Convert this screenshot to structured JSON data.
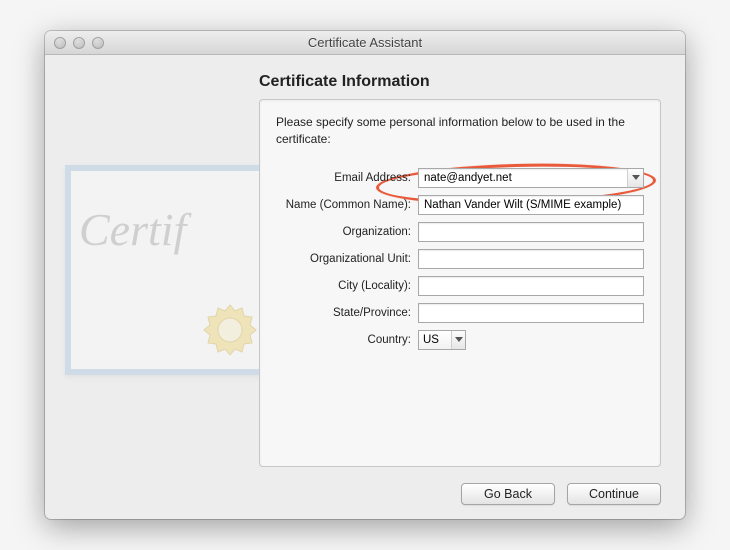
{
  "window": {
    "title": "Certificate Assistant"
  },
  "heading": "Certificate Information",
  "instruction": "Please specify some personal information below to be used in the certificate:",
  "cert_bg_text": "Certif",
  "form": {
    "email_label": "Email Address:",
    "email_value": "nate@andyet.net",
    "name_label": "Name (Common Name):",
    "name_value": "Nathan Vander Wilt (S/MIME example)",
    "org_label": "Organization:",
    "org_value": "",
    "ou_label": "Organizational Unit:",
    "ou_value": "",
    "city_label": "City (Locality):",
    "city_value": "",
    "state_label": "State/Province:",
    "state_value": "",
    "country_label": "Country:",
    "country_value": "US"
  },
  "buttons": {
    "back": "Go Back",
    "continue": "Continue"
  }
}
